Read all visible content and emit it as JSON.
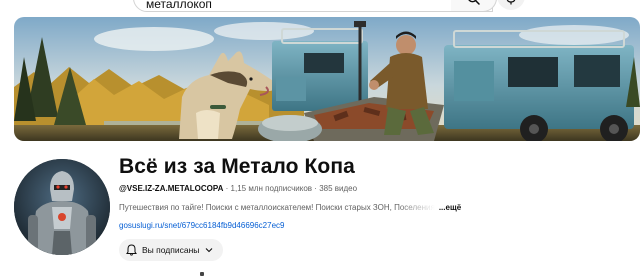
{
  "search": {
    "value": "металлокоп",
    "keyboard_icon": "keyboard-icon",
    "search_icon": "search-icon",
    "mic_icon": "microphone-icon"
  },
  "banner": {
    "description_icon": "channel-banner-image"
  },
  "channel": {
    "name": "Всё из за Метало Копа",
    "handle": "@VSE.IZ-ZA.METALOCOPA",
    "separator": "·",
    "subscribers": "1,15 млн подписчиков",
    "videos": "385 видео",
    "description": "Путешествия по тайге! Поиски с металлоискателем! Поиски старых ЗОН, Поселения",
    "more_label": "...ещё",
    "link": "gosuslugi.ru/snet/679cc6184fb9d46696c27ec9",
    "subscribe_label": "Вы подписаны"
  },
  "colors": {
    "link": "#065fd4",
    "secondary_text": "#606060",
    "button_bg": "#f2f2f2"
  }
}
